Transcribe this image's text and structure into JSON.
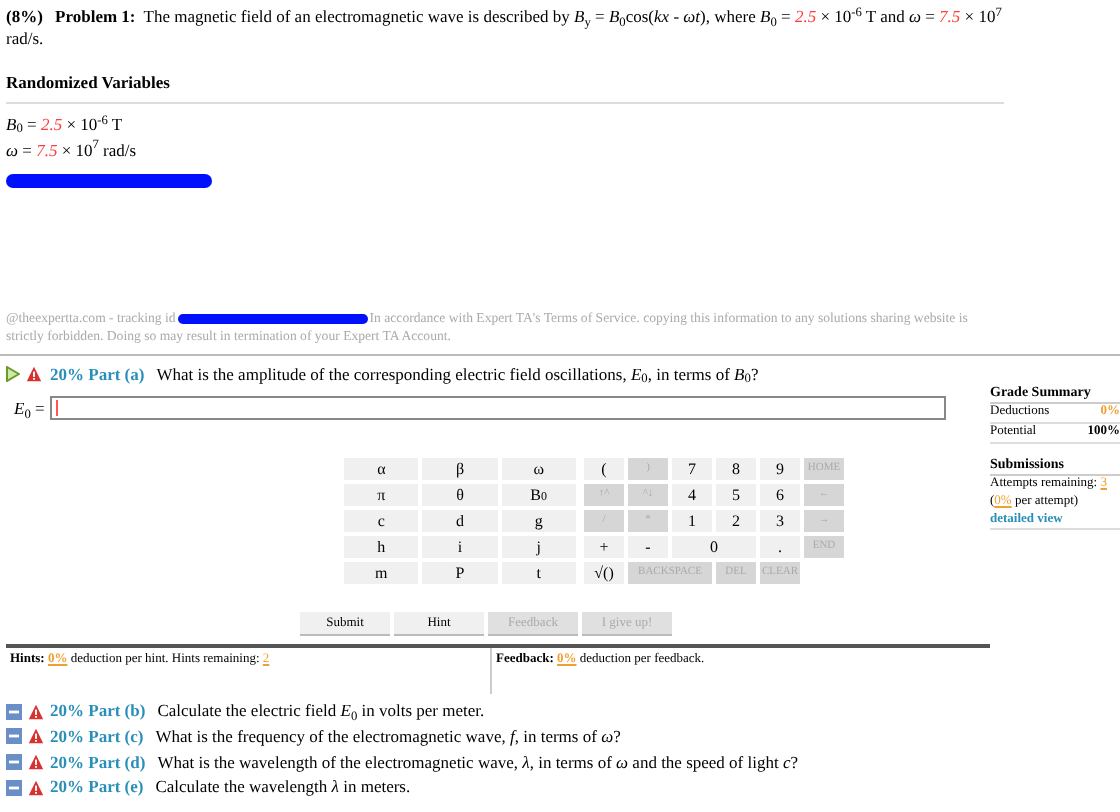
{
  "problem": {
    "weight": "(8%)",
    "title": "Problem 1:",
    "segments": [
      {
        "text": "The magnetic field of an electromagnetic wave is described by *B*$_{y}$ = *B*$_{0}$cos(*kx* - *ωt*), where *B*$_{0}$ = ",
        "highlight": false
      },
      {
        "text": "2.5",
        "highlight": true
      },
      {
        "text": " × 10$^{-6}$ T and *ω* = ",
        "highlight": false
      },
      {
        "text": "7.5",
        "highlight": true
      },
      {
        "text": " × 10$^{7}$ rad/s.",
        "highlight": false
      }
    ]
  },
  "randomized": {
    "heading": "Randomized Variables",
    "lines": [
      [
        {
          "text": "*B*$_{0}$ = ",
          "highlight": false
        },
        {
          "text": "2.5",
          "highlight": true
        },
        {
          "text": " × 10$^{-6}$ T",
          "highlight": false
        }
      ],
      [
        {
          "text": "*ω* = ",
          "highlight": false
        },
        {
          "text": "7.5",
          "highlight": true
        },
        {
          "text": " × 10$^{7}$ rad/s",
          "highlight": false
        }
      ]
    ]
  },
  "notice": {
    "before": "@theexpertta.com - tracking id",
    "after": "In accordance with Expert TA's Terms of Service. copying this information to any solutions sharing website is strictly forbidden. Doing so may result in termination of your Expert TA Account."
  },
  "part_a": {
    "label": "20% Part (a)",
    "question": "What is the amplitude of the corresponding electric field oscillations, *E*$_{0}$, in terms of *B*$_{0}$?",
    "field_label": "*E*$_{0}$ =",
    "expanded": true
  },
  "keypad": {
    "symbols": [
      [
        "α",
        "β",
        "ω"
      ],
      [
        "π",
        "θ",
        "B$_{0}$"
      ],
      [
        "c",
        "d",
        "g"
      ],
      [
        "h",
        "i",
        "j"
      ],
      [
        "m",
        "P",
        "t"
      ]
    ],
    "keys": [
      [
        {
          "label": "(",
          "disabled": false,
          "kind": "single"
        },
        {
          "label": ")",
          "disabled": true,
          "kind": "single"
        },
        {
          "label": "7",
          "disabled": false,
          "kind": "single"
        },
        {
          "label": "8",
          "disabled": false,
          "kind": "single"
        },
        {
          "label": "9",
          "disabled": false,
          "kind": "single"
        },
        {
          "label": "HOME",
          "disabled": true,
          "kind": "single"
        }
      ],
      [
        {
          "label": "↑^",
          "disabled": true,
          "kind": "single"
        },
        {
          "label": "^↓",
          "disabled": true,
          "kind": "single"
        },
        {
          "label": "4",
          "disabled": false,
          "kind": "single"
        },
        {
          "label": "5",
          "disabled": false,
          "kind": "single"
        },
        {
          "label": "6",
          "disabled": false,
          "kind": "single"
        },
        {
          "label": "←",
          "disabled": true,
          "kind": "single"
        }
      ],
      [
        {
          "label": "/",
          "disabled": true,
          "kind": "single"
        },
        {
          "label": "*",
          "disabled": true,
          "kind": "single"
        },
        {
          "label": "1",
          "disabled": false,
          "kind": "single"
        },
        {
          "label": "2",
          "disabled": false,
          "kind": "single"
        },
        {
          "label": "3",
          "disabled": false,
          "kind": "single"
        },
        {
          "label": "→",
          "disabled": true,
          "kind": "single"
        }
      ],
      [
        {
          "label": "+",
          "disabled": false,
          "kind": "single"
        },
        {
          "label": "-",
          "disabled": false,
          "kind": "single"
        },
        {
          "label": "0",
          "disabled": false,
          "kind": "wide"
        },
        {
          "label": ".",
          "disabled": false,
          "kind": "single"
        },
        {
          "label": "END",
          "disabled": true,
          "kind": "single"
        }
      ],
      [
        {
          "label": "√()",
          "disabled": false,
          "kind": "single"
        },
        {
          "label": "BACKSPACE",
          "disabled": true,
          "kind": "wide"
        },
        {
          "label": "DEL",
          "disabled": true,
          "kind": "single"
        },
        {
          "label": "CLEAR",
          "disabled": true,
          "kind": "single"
        }
      ]
    ]
  },
  "buttons": [
    {
      "label": "Submit",
      "disabled": false
    },
    {
      "label": "Hint",
      "disabled": false
    },
    {
      "label": "Feedback",
      "disabled": true
    },
    {
      "label": "I give up!",
      "disabled": true
    }
  ],
  "hints": {
    "label": "Hints:",
    "pct": "0%",
    "text": "deduction per hint. Hints remaining:",
    "remaining": "2"
  },
  "feedback": {
    "label": "Feedback:",
    "pct": "0%",
    "text": "deduction per feedback."
  },
  "grade_summary": {
    "heading": "Grade Summary",
    "rows": [
      {
        "label": "Deductions",
        "value": "0%",
        "highlight": true
      },
      {
        "label": "Potential",
        "value": "100%",
        "highlight": false
      }
    ]
  },
  "submissions": {
    "heading": "Submissions",
    "attempts_label": "Attempts remaining:",
    "attempts": "3",
    "per_attempt_pct": "0%",
    "per_attempt_text": "per attempt)",
    "open": "(",
    "link": "detailed view"
  },
  "other_parts": [
    {
      "label": "20% Part (b)",
      "question": "Calculate the electric field *E*$_{0}$ in volts per meter.",
      "expanded": false
    },
    {
      "label": "20% Part (c)",
      "question": "What is the frequency of the electromagnetic wave, *f*, in terms of *ω*?",
      "expanded": false
    },
    {
      "label": "20% Part (d)",
      "question": "What is the wavelength of the electromagnetic wave, *λ*, in terms of *ω* and the speed of light *c*?",
      "expanded": false
    },
    {
      "label": "20% Part (e)",
      "question": "Calculate the wavelength *λ* in meters.",
      "expanded": false
    }
  ]
}
